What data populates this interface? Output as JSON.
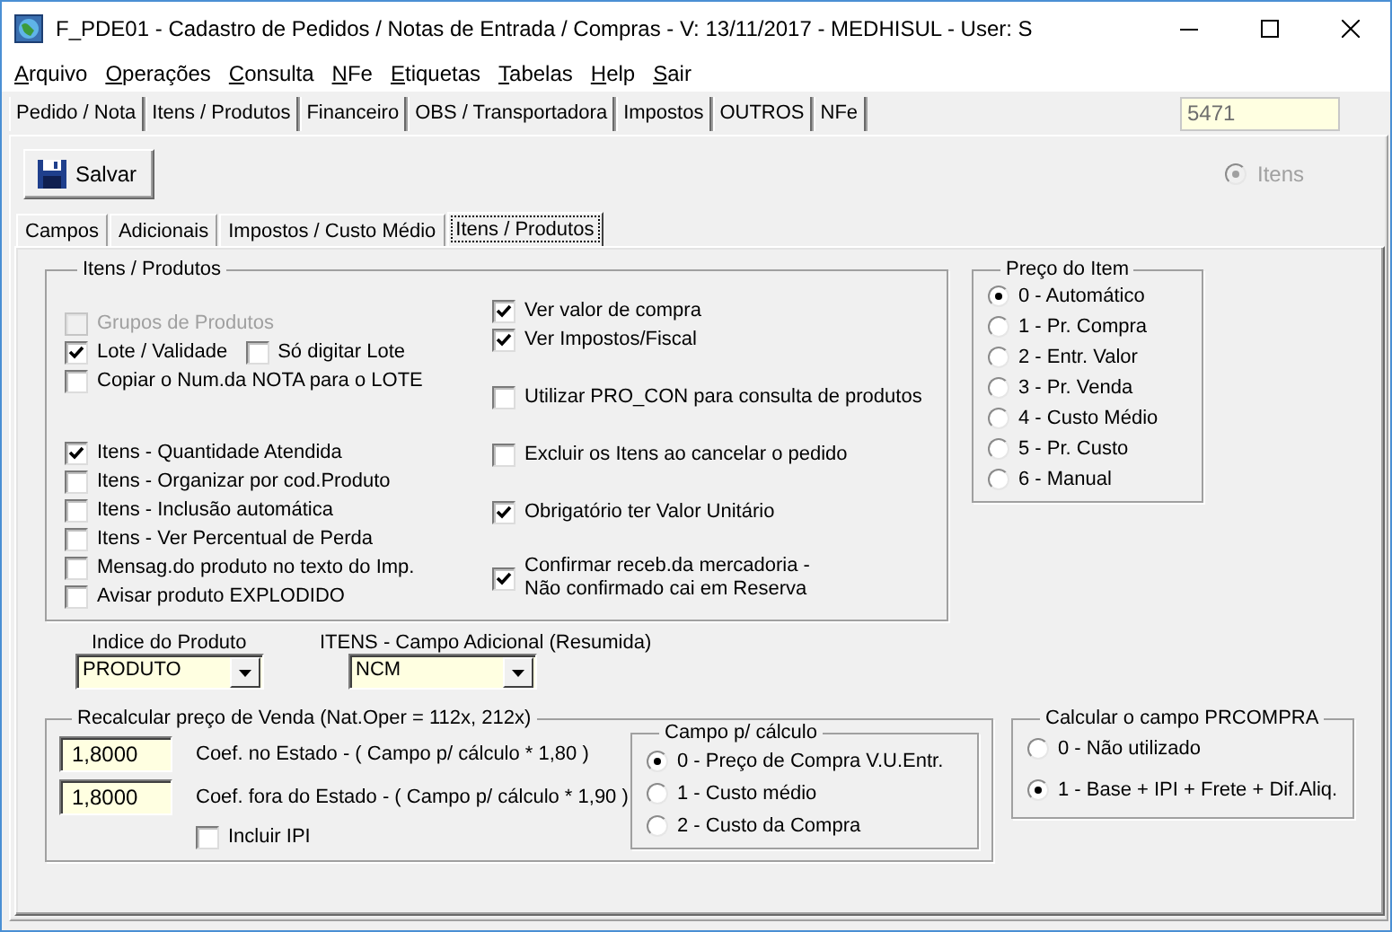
{
  "window": {
    "title": "F_PDE01 - Cadastro de Pedidos / Notas de Entrada / Compras - V: 13/11/2017 - MEDHISUL - User: S"
  },
  "menu": [
    "Arquivo",
    "Operações",
    "Consulta",
    "NFe",
    "Etiquetas",
    "Tabelas",
    "Help",
    "Sair"
  ],
  "main_tabs": [
    "Pedido / Nota",
    "Itens / Produtos",
    "Financeiro",
    "OBS / Transportadora",
    "Impostos",
    "OUTROS",
    "NFe"
  ],
  "record_field": {
    "value": "5471"
  },
  "toolbar": {
    "save_button": "Salvar",
    "itens_option": {
      "label": "Itens",
      "selected": true,
      "disabled": true
    }
  },
  "sub_tabs": [
    {
      "label": "Campos",
      "selected": false
    },
    {
      "label": "Adicionais",
      "selected": false
    },
    {
      "label": "Impostos / Custo Médio",
      "selected": false
    },
    {
      "label": "Itens / Produtos",
      "selected": true
    }
  ],
  "itens_produtos": {
    "title": "Itens / Produtos",
    "left_groups": [
      [
        [
          {
            "label": "Grupos de Produtos",
            "checked": false,
            "disabled": true
          }
        ],
        [
          {
            "label": "Lote / Validade",
            "checked": true,
            "disabled": false
          },
          {
            "label": "Só digitar Lote",
            "checked": false,
            "disabled": false
          }
        ],
        [
          {
            "label": "Copiar o Num.da NOTA para o LOTE",
            "checked": false,
            "disabled": false
          }
        ]
      ],
      [
        [
          {
            "label": "Itens - Quantidade Atendida",
            "checked": true,
            "disabled": false
          }
        ],
        [
          {
            "label": "Itens - Organizar por cod.Produto",
            "checked": false,
            "disabled": false
          }
        ],
        [
          {
            "label": "Itens - Inclusão automática",
            "checked": false,
            "disabled": false
          }
        ],
        [
          {
            "label": "Itens - Ver Percentual de Perda",
            "checked": false,
            "disabled": false
          }
        ],
        [
          {
            "label": "Mensag.do produto no texto do Imp.",
            "checked": false,
            "disabled": false
          }
        ],
        [
          {
            "label": "Avisar produto EXPLODIDO",
            "checked": false,
            "disabled": false
          }
        ]
      ]
    ],
    "right_groups": [
      [
        {
          "label": "Ver valor de compra",
          "checked": true
        },
        {
          "label": "Ver Impostos/Fiscal",
          "checked": true
        }
      ],
      [
        {
          "label": "Utilizar PRO_CON para consulta de produtos",
          "checked": false
        }
      ],
      [
        {
          "label": "Excluir os Itens ao cancelar o pedido",
          "checked": false
        }
      ],
      [
        {
          "label": "Obrigatório ter Valor Unitário",
          "checked": true
        }
      ],
      [
        {
          "label": "Confirmar receb.da mercadoria -\nNão confirmado cai em Reserva",
          "checked": true
        }
      ]
    ]
  },
  "preco_do_item": {
    "title": "Preço do Item",
    "options": [
      {
        "label": "0 - Automático",
        "selected": true
      },
      {
        "label": "1 - Pr. Compra",
        "selected": false
      },
      {
        "label": "2 - Entr. Valor",
        "selected": false
      },
      {
        "label": "3 - Pr. Venda",
        "selected": false
      },
      {
        "label": "4 - Custo Médio",
        "selected": false
      },
      {
        "label": "5 - Pr. Custo",
        "selected": false
      },
      {
        "label": "6 - Manual",
        "selected": false
      }
    ]
  },
  "indice_do_produto": {
    "label": "Indice do Produto",
    "value": "PRODUTO"
  },
  "campo_adicional": {
    "label": "ITENS - Campo Adicional (Resumida)",
    "value": "NCM"
  },
  "recalcular": {
    "title": "Recalcular preço de Venda (Nat.Oper = 112x, 212x)",
    "coefficients": [
      {
        "value": "1,8000",
        "label": "Coef. no Estado - ( Campo p/ cálculo * 1,80 )"
      },
      {
        "value": "1,8000",
        "label": "Coef. fora do Estado - ( Campo p/ cálculo * 1,90 )"
      }
    ],
    "incluir_ipi": {
      "label": "Incluir IPI",
      "checked": false
    },
    "campo_calculo": {
      "title": "Campo p/ cálculo",
      "options": [
        {
          "label": "0 - Preço de Compra V.U.Entr.",
          "selected": true
        },
        {
          "label": "1 - Custo médio",
          "selected": false
        },
        {
          "label": "2 - Custo da Compra",
          "selected": false
        }
      ]
    }
  },
  "calcular_prcompra": {
    "title": "Calcular o campo PRCOMPRA",
    "options": [
      {
        "label": "0 - Não utilizado",
        "selected": false
      },
      {
        "label": "1 - Base + IPI + Frete + Dif.Aliq.",
        "selected": true
      }
    ]
  }
}
